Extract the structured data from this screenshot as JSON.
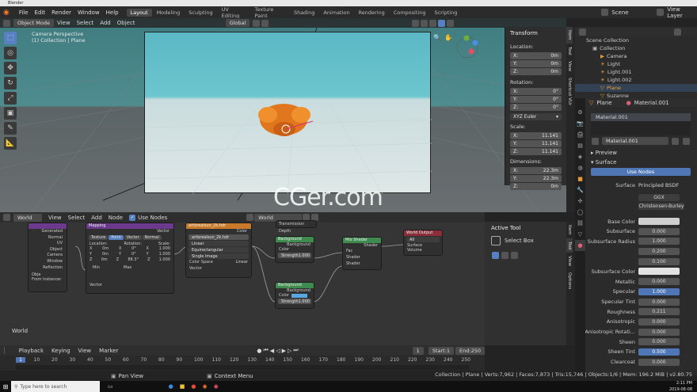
{
  "window": {
    "title": "Blender"
  },
  "menus": [
    "File",
    "Edit",
    "Render",
    "Window",
    "Help"
  ],
  "workspaces": [
    {
      "label": "Layout",
      "active": true
    },
    {
      "label": "Modeling"
    },
    {
      "label": "Sculpting"
    },
    {
      "label": "UV Editing"
    },
    {
      "label": "Texture Paint"
    },
    {
      "label": "Shading"
    },
    {
      "label": "Animation"
    },
    {
      "label": "Rendering"
    },
    {
      "label": "Compositing"
    },
    {
      "label": "Scripting"
    }
  ],
  "scene": {
    "name": "Scene",
    "view_layer": "View Layer"
  },
  "viewport": {
    "mode": "Object Mode",
    "menu": [
      "View",
      "Select",
      "Add",
      "Object"
    ],
    "orientation": "Global",
    "overlay_line1": "Camera Perspective",
    "overlay_line2": "(1) Collection | Plane",
    "watermark": "CGer.com"
  },
  "npanel": {
    "section": "Transform",
    "tabs": [
      "Item",
      "Tool",
      "View",
      "Shortcut VUr"
    ],
    "location_label": "Location:",
    "location": [
      {
        "axis": "X:",
        "value": "0m"
      },
      {
        "axis": "Y:",
        "value": "0m"
      },
      {
        "axis": "Z:",
        "value": "0m"
      }
    ],
    "rotation_label": "Rotation:",
    "rotation": [
      {
        "axis": "X:",
        "value": "0°"
      },
      {
        "axis": "Y:",
        "value": "0°"
      },
      {
        "axis": "Z:",
        "value": "0°"
      }
    ],
    "rotation_mode": "XYZ Euler",
    "scale_label": "Scale:",
    "scale": [
      {
        "axis": "X:",
        "value": "11.141"
      },
      {
        "axis": "Y:",
        "value": "11.141"
      },
      {
        "axis": "Z:",
        "value": "11.141"
      }
    ],
    "dimensions_label": "Dimensions:",
    "dimensions": [
      {
        "axis": "X:",
        "value": "22.3m"
      },
      {
        "axis": "Y:",
        "value": "22.3m"
      },
      {
        "axis": "Z:",
        "value": "0m"
      }
    ]
  },
  "outliner": {
    "root": "Scene Collection",
    "items": [
      {
        "label": "Collection"
      },
      {
        "label": "Camera"
      },
      {
        "label": "Light"
      },
      {
        "label": "Light.001"
      },
      {
        "label": "Light.002"
      },
      {
        "label": "Plane",
        "selected": true
      },
      {
        "label": "Suzanne"
      }
    ]
  },
  "node_editor": {
    "world": "World",
    "menu": [
      "View",
      "Select",
      "Add",
      "Node"
    ],
    "use_nodes": "Use Nodes",
    "world_name": "World",
    "footer": "World",
    "nodes": {
      "coord": {
        "outputs": [
          "Generated",
          "Normal",
          "UV",
          "Object",
          "Camera",
          "Window",
          "Reflection"
        ],
        "obj_label": "Obje",
        "from_instancer": "From Instancer"
      },
      "mapping": {
        "title": "Mapping",
        "vector": "Vector",
        "tabs": [
          "Texture",
          "Point",
          "Vector",
          "Normal"
        ],
        "cols": [
          "Location:",
          "Rotation:",
          "Scale:"
        ],
        "rows": [
          [
            "X",
            "0m",
            "X",
            "0°",
            "X",
            "1.000"
          ],
          [
            "Y",
            "0m",
            "Y",
            "0°",
            "Y",
            "1.000"
          ],
          [
            "Z",
            "0m",
            "Z",
            "88.3°",
            "Z",
            "1.000"
          ]
        ],
        "min": "Min",
        "max": "Max",
        "out": "Vector"
      },
      "envtex": {
        "title": "artbrealsun_2k.hdr",
        "color": "Color",
        "file": "artbrealsun_2k.hdr",
        "interp": "Linear",
        "proj": "Equirectangular",
        "single": "Single Image",
        "cs_label": "Color Space",
        "cs_value": "Linear",
        "vector": "Vector"
      },
      "lightpath": {
        "out": "Transmission Depth"
      },
      "bg1": {
        "title": "Background",
        "out": "Background",
        "color": "Color",
        "strength_label": "Strength",
        "strength": "1.000"
      },
      "bg2": {
        "title": "Background",
        "out": "Background",
        "color": "Color",
        "strength_label": "Strength",
        "strength": "1.000"
      },
      "mix": {
        "title": "Mix Shader",
        "out": "Shader",
        "fac": "Fac",
        "s1": "Shader",
        "s2": "Shader"
      },
      "output": {
        "title": "World Output",
        "target": "All",
        "surface": "Surface",
        "volume": "Volume"
      }
    }
  },
  "active_tool": {
    "title": "Active Tool",
    "name": "Select Box",
    "tabs": [
      "Item",
      "Tool",
      "View",
      "Options"
    ]
  },
  "properties": {
    "object": "Plane",
    "material": "Material.001",
    "slot": "Material.001",
    "slot_field": "Material.001",
    "preview": "Preview",
    "surface": "Surface",
    "use_nodes": "Use Nodes",
    "surface_label": "Surface",
    "surface_value": "Principled BSDF",
    "dist": "GGX",
    "sss_method": "Christensen-Burley",
    "fields": [
      {
        "label": "Base Color",
        "value": "",
        "swatch": "#cfcfcf"
      },
      {
        "label": "Subsurface",
        "value": "0.000"
      },
      {
        "label": "Subsurface Radius",
        "value": "1.000"
      },
      {
        "label": "",
        "value": "0.200"
      },
      {
        "label": "",
        "value": "0.100"
      },
      {
        "label": "Subsurface Color",
        "value": "",
        "swatch": "#e2e2e2"
      },
      {
        "label": "Metallic",
        "value": "0.000"
      },
      {
        "label": "Specular",
        "value": "1.000",
        "blue": true
      },
      {
        "label": "Specular Tint",
        "value": "0.000"
      },
      {
        "label": "Roughness",
        "value": "0.211"
      },
      {
        "label": "Anisotropic",
        "value": "0.000"
      },
      {
        "label": "Anisotropic Rotati...",
        "value": "0.000"
      },
      {
        "label": "Sheen",
        "value": "0.000"
      },
      {
        "label": "Sheen Tint",
        "value": "0.500",
        "blue": true
      },
      {
        "label": "Clearcoat",
        "value": "0.000"
      }
    ]
  },
  "timeline": {
    "menu": [
      "Playback",
      "Keying",
      "View",
      "Marker"
    ],
    "frame": "1",
    "start_label": "Start:",
    "start": "1",
    "end_label": "End:",
    "end": "250",
    "ticks": [
      "1",
      "10",
      "20",
      "30",
      "40",
      "50",
      "60",
      "70",
      "80",
      "90",
      "100",
      "110",
      "120",
      "130",
      "140",
      "150",
      "160",
      "170",
      "180",
      "190",
      "200",
      "210",
      "220",
      "230",
      "240",
      "250"
    ]
  },
  "status": {
    "pan": "Pan View",
    "context": "Context Menu",
    "info": "Collection | Plane | Verts:7,962 | Faces:7,873 | Tris:15,746 | Objects:1/6 | Mem: 196.2 MiB | v2.80.75"
  },
  "taskbar": {
    "search": "Type here to search",
    "time": "2:11 PM",
    "date": "2019-08-08"
  }
}
